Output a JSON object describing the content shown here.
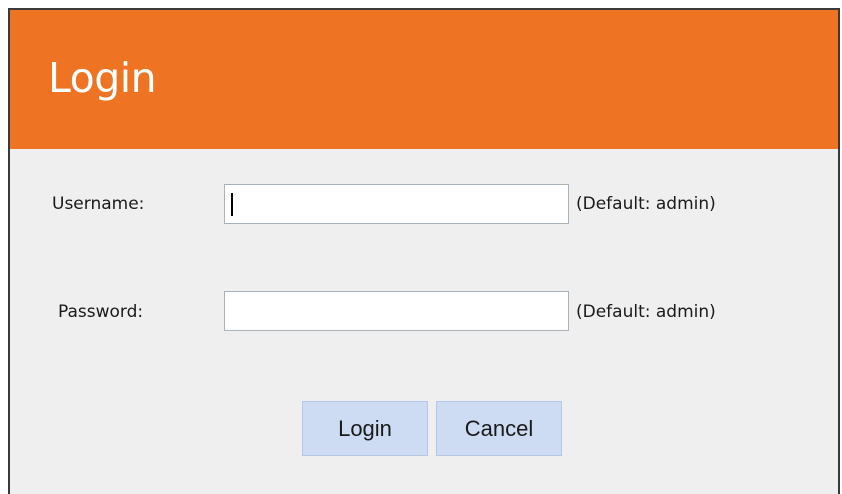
{
  "header": {
    "title": "Login"
  },
  "form": {
    "username": {
      "label": "Username:",
      "value": "",
      "hint": "(Default: admin)"
    },
    "password": {
      "label": "Password:",
      "value": "",
      "hint": "(Default: admin)"
    }
  },
  "buttons": {
    "login_label": "Login",
    "cancel_label": "Cancel"
  },
  "colors": {
    "header_bg": "#ee7322",
    "body_bg": "#efefef",
    "button_bg": "#cddcf3"
  }
}
